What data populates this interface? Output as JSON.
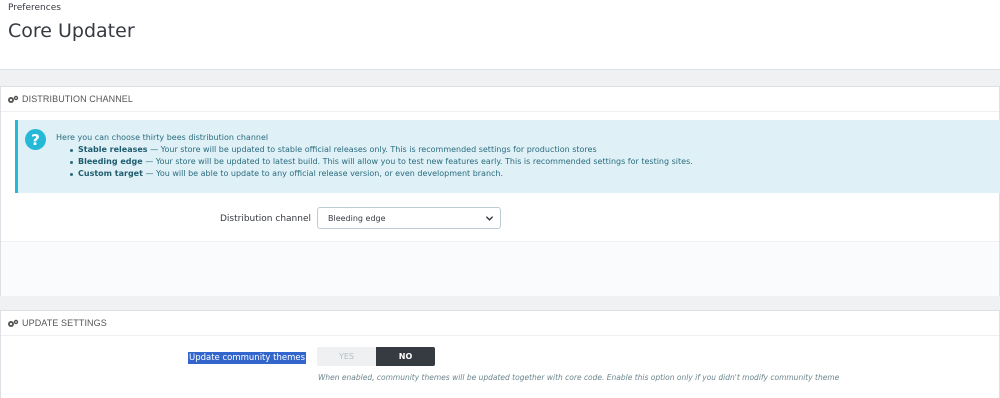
{
  "header": {
    "breadcrumb": "Preferences",
    "title": "Core Updater"
  },
  "distribution_panel": {
    "heading": "DISTRIBUTION CHANNEL",
    "alert": {
      "intro": "Here you can choose thirty bees distribution channel",
      "items": [
        {
          "title": "Stable releases",
          "text": " — Your store will be updated to stable official releases only. This is recommended settings for production stores"
        },
        {
          "title": "Bleeding edge",
          "text": " — Your store will be updated to latest build. This will allow you to test new features early. This is recommended settings for testing sites."
        },
        {
          "title": "Custom target",
          "text": " — You will be able to update to any official release version, or even development branch."
        }
      ]
    },
    "channel_label": "Distribution channel",
    "channel_value": "Bleeding edge"
  },
  "update_panel": {
    "heading": "UPDATE SETTINGS",
    "community_themes_label": "Update community themes",
    "toggle_yes": "YES",
    "toggle_no": "NO",
    "help": "When enabled, community themes will be updated together with core code. Enable this option only if you didn't modify community theme"
  },
  "colors": {
    "accent": "#25b9d7",
    "alert_bg": "#dff1f7",
    "toggle_active": "#363a41",
    "selection": "#3366cc"
  },
  "icons": [
    "gears-icon",
    "question-circle-icon",
    "chevron-down-icon"
  ]
}
